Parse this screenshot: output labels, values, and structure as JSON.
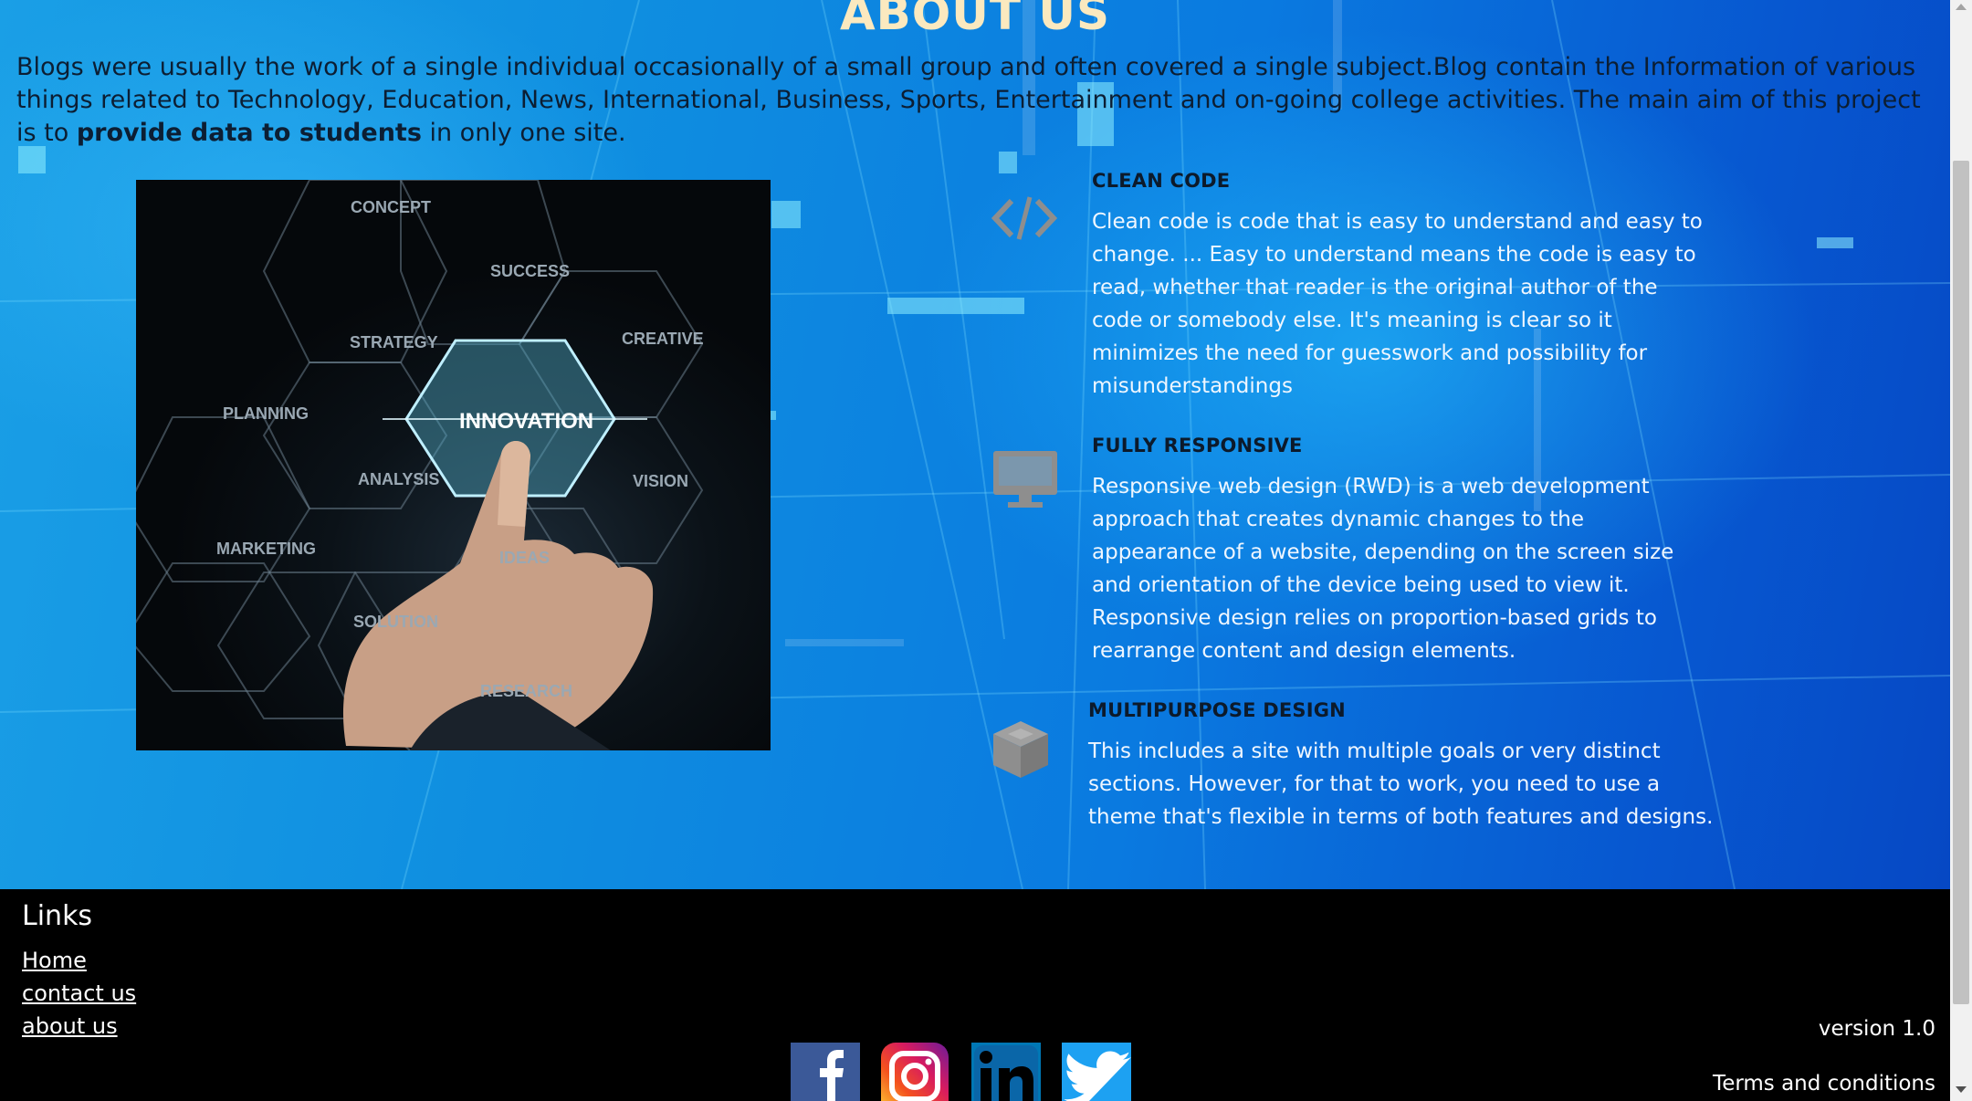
{
  "about": {
    "title": "ABOUT US",
    "intro_part1": "Blogs were usually the work of a single individual occasionally of a small group and often covered a single subject.Blog contain the Information of various things related to Technology, Education, News, International, Business, Sports, Entertainment and on-going college activities. The main aim of this project is to ",
    "intro_bold": "provide data to students",
    "intro_part2": " in only one site."
  },
  "image": {
    "labels": [
      "CONCEPT",
      "SUCCESS",
      "STRATEGY",
      "CREATIVE",
      "PLANNING",
      "INNOVATION",
      "ANALYSIS",
      "VISION",
      "MARKETING",
      "IDEAS",
      "SOLUTION",
      "RESEARCH"
    ]
  },
  "features": [
    {
      "icon": "code-icon",
      "title": "CLEAN CODE",
      "text": "Clean code is code that is easy to understand and easy to change. ... Easy to understand means the code is easy to read, whether that reader is the original author of the code or somebody else. It's meaning is clear so it minimizes the need for guesswork and possibility for misunderstandings"
    },
    {
      "icon": "monitor-icon",
      "title": "FULLY RESPONSIVE",
      "text": "Responsive web design (RWD) is a web development approach that creates dynamic changes to the appearance of a website, depending on the screen size and orientation of the device being used to view it. Responsive design relies on proportion-based grids to rearrange content and design elements."
    },
    {
      "icon": "cube-icon",
      "title": "MULTIPURPOSE DESIGN",
      "text": "This includes a site with multiple goals or very distinct sections. However, for that to work, you need to use a theme that's flexible in terms of both features and designs."
    }
  ],
  "footer": {
    "links_heading": "Links",
    "links": [
      "Home",
      "contact us",
      "about us"
    ],
    "version": "version 1.0",
    "terms": "Terms and conditions",
    "social": [
      "facebook-icon",
      "instagram-icon",
      "linkedin-icon",
      "twitter-icon"
    ],
    "colors": {
      "facebook": "#3b5998",
      "linkedin": "#0077b5",
      "twitter": "#1da1f2"
    }
  }
}
